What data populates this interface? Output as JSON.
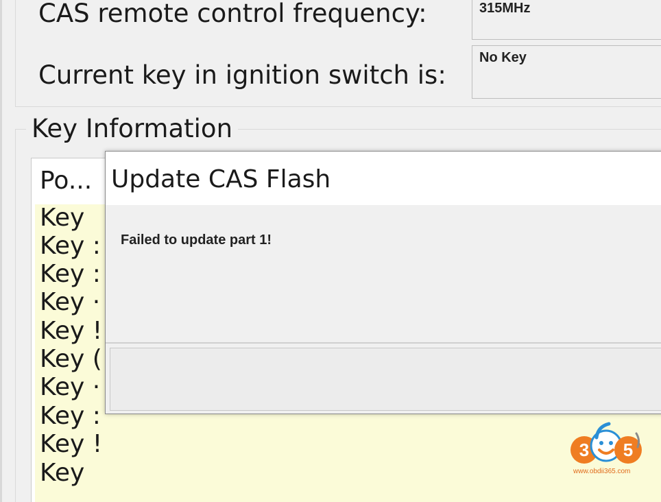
{
  "top_fields": {
    "frequency_label": "CAS remote control frequency:",
    "frequency_value": "315MHz",
    "ignition_label": "Current key in ignition switch is:",
    "ignition_value": "No Key"
  },
  "key_information": {
    "title": "Key Information",
    "column_header": "Po...",
    "rows": [
      "Key",
      "Key :",
      "Key :",
      "Key ·",
      "Key !",
      "Key (",
      "Key ·",
      "Key :",
      "Key !",
      "Key"
    ]
  },
  "dialog": {
    "title": "Update CAS Flash",
    "message": "Failed to update part 1!"
  },
  "watermark": {
    "logo_text": "365",
    "url": "www.obdii365.com",
    "colors": {
      "orange": "#ef7d22",
      "blue": "#2a8fd6"
    }
  }
}
